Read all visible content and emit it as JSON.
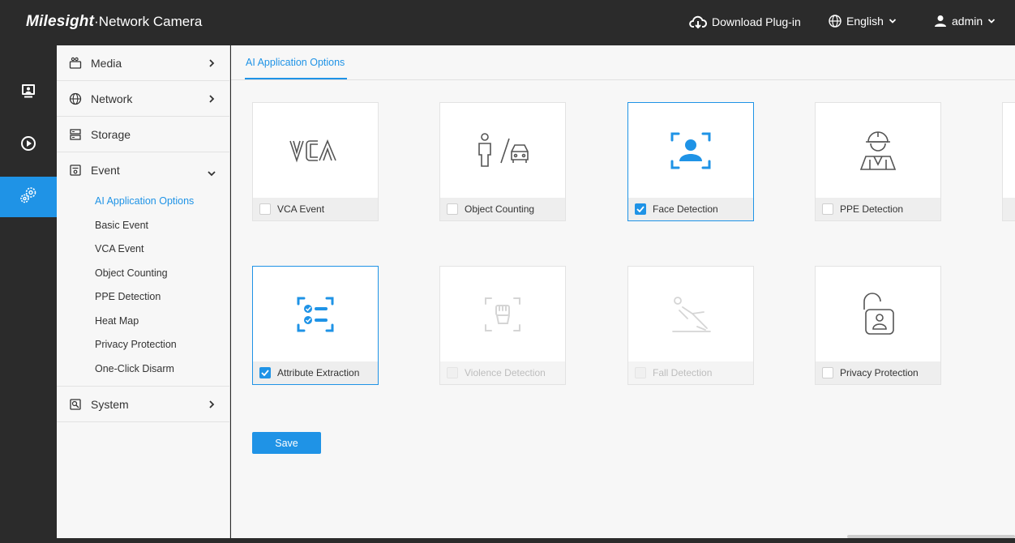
{
  "header": {
    "brand": "Milesight",
    "product": "·Network Camera",
    "download": "Download Plug-in",
    "language": "English",
    "user": "admin"
  },
  "nav": {
    "media": "Media",
    "network": "Network",
    "storage": "Storage",
    "event": "Event",
    "event_items": [
      "AI Application Options",
      "Basic Event",
      "VCA Event",
      "Object Counting",
      "PPE Detection",
      "Heat Map",
      "Privacy Protection",
      "One-Click Disarm"
    ],
    "system": "System"
  },
  "main": {
    "tab": "AI Application Options",
    "cards": [
      {
        "label": "VCA Event",
        "checked": false,
        "enabled": true,
        "icon": "vca-icon"
      },
      {
        "label": "Object Counting",
        "checked": false,
        "enabled": true,
        "icon": "person-car-icon"
      },
      {
        "label": "Face Detection",
        "checked": true,
        "enabled": true,
        "icon": "face-scan-icon"
      },
      {
        "label": "PPE Detection",
        "checked": false,
        "enabled": true,
        "icon": "hardhat-worker-icon"
      },
      {
        "label": "Attribute Extraction",
        "checked": true,
        "enabled": true,
        "icon": "attribute-list-icon"
      },
      {
        "label": "Violence Detection",
        "checked": false,
        "enabled": false,
        "icon": "fist-scan-icon"
      },
      {
        "label": "Fall Detection",
        "checked": false,
        "enabled": false,
        "icon": "fall-person-icon"
      },
      {
        "label": "Privacy Protection",
        "checked": false,
        "enabled": true,
        "icon": "unlock-person-icon"
      }
    ],
    "save": "Save"
  },
  "colors": {
    "accent": "#1f93e6",
    "topbar": "#2b2b2b",
    "panel": "#f7f7f7"
  }
}
